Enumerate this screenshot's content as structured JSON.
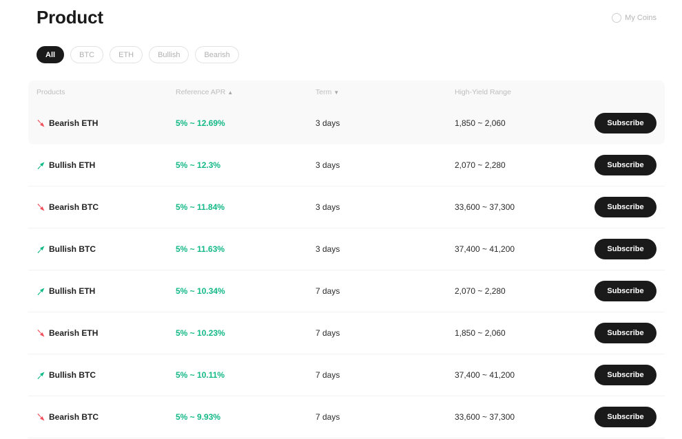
{
  "page": {
    "title": "Product"
  },
  "toggle": {
    "label": "My Coins"
  },
  "filters": [
    {
      "label": "All",
      "active": true
    },
    {
      "label": "BTC",
      "active": false
    },
    {
      "label": "ETH",
      "active": false
    },
    {
      "label": "Bullish",
      "active": false
    },
    {
      "label": "Bearish",
      "active": false
    }
  ],
  "columns": {
    "products": "Products",
    "apr": "Reference APR",
    "term": "Term",
    "range": "High-Yield Range"
  },
  "colors": {
    "bullish": "#12b886",
    "bearish": "#f0505a",
    "apr": "#12b886",
    "button": "#1a1a1a"
  },
  "rows": [
    {
      "direction": "bearish",
      "product": "Bearish ETH",
      "apr": "5% ~ 12.69%",
      "term": "3 days",
      "range": "1,850 ~ 2,060",
      "action": "Subscribe"
    },
    {
      "direction": "bullish",
      "product": "Bullish ETH",
      "apr": "5% ~ 12.3%",
      "term": "3 days",
      "range": "2,070 ~ 2,280",
      "action": "Subscribe"
    },
    {
      "direction": "bearish",
      "product": "Bearish BTC",
      "apr": "5% ~ 11.84%",
      "term": "3 days",
      "range": "33,600 ~ 37,300",
      "action": "Subscribe"
    },
    {
      "direction": "bullish",
      "product": "Bullish BTC",
      "apr": "5% ~ 11.63%",
      "term": "3 days",
      "range": "37,400 ~ 41,200",
      "action": "Subscribe"
    },
    {
      "direction": "bullish",
      "product": "Bullish ETH",
      "apr": "5% ~ 10.34%",
      "term": "7 days",
      "range": "2,070 ~ 2,280",
      "action": "Subscribe"
    },
    {
      "direction": "bearish",
      "product": "Bearish ETH",
      "apr": "5% ~ 10.23%",
      "term": "7 days",
      "range": "1,850 ~ 2,060",
      "action": "Subscribe"
    },
    {
      "direction": "bullish",
      "product": "Bullish BTC",
      "apr": "5% ~ 10.11%",
      "term": "7 days",
      "range": "37,400 ~ 41,200",
      "action": "Subscribe"
    },
    {
      "direction": "bearish",
      "product": "Bearish BTC",
      "apr": "5% ~ 9.93%",
      "term": "7 days",
      "range": "33,600 ~ 37,300",
      "action": "Subscribe"
    }
  ]
}
